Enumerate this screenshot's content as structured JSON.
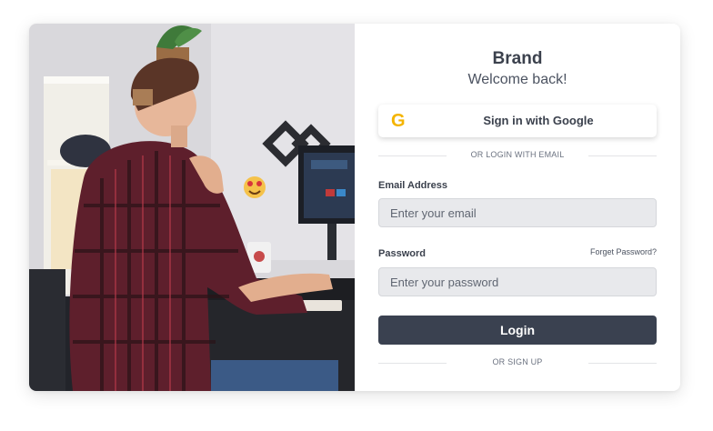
{
  "brand": {
    "name": "Brand",
    "welcome": "Welcome back!"
  },
  "google": {
    "label": "Sign in with Google",
    "icon": "google-g-icon",
    "icon_glyph": "G",
    "icon_color": "#f4b400"
  },
  "divider_email": "OR LOGIN WITH EMAIL",
  "email": {
    "label": "Email Address",
    "placeholder": "Enter your email",
    "value": ""
  },
  "password": {
    "label": "Password",
    "placeholder": "Enter your password",
    "value": "",
    "forgot_label": "Forget Password?"
  },
  "login": {
    "label": "Login"
  },
  "divider_signup": "OR SIGN UP",
  "colors": {
    "primary_button": "#3a4150",
    "text": "#3b414d",
    "input_bg": "#e8e9ec"
  }
}
